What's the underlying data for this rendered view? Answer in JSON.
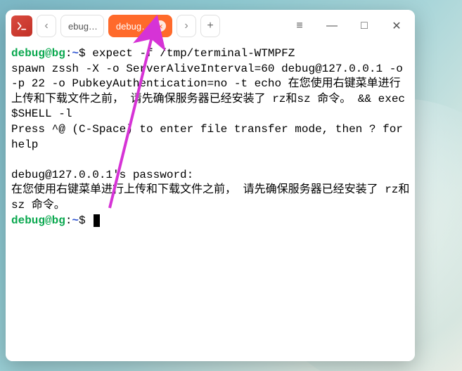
{
  "tabs": {
    "prev_glyph": "‹",
    "next_glyph": "›",
    "add_glyph": "+",
    "inactive_label": "ebug…",
    "active_label": "debug…",
    "close_glyph": "×"
  },
  "window_controls": {
    "menu": "≡",
    "minimize": "—",
    "maximize": "□",
    "close": "✕"
  },
  "terminal": {
    "prompt_user": "debug@bg",
    "prompt_sep": ":",
    "prompt_path": "~",
    "prompt_char": "$",
    "line1_cmd": " expect -f /tmp/terminal-WTMPFZ",
    "line2": "spawn zssh -X -o ServerAliveInterval=60 debug@127.0.0.1 -o -p 22 -o PubkeyAuthentication=no -t echo 在您使用右键菜单进行上传和下载文件之前， 请先确保服务器已经安装了 rz和sz 命令。 && exec $SHELL -l",
    "line3": "Press ^@ (C-Space) to enter file transfer mode, then ? for help",
    "blank": "",
    "line4": "debug@127.0.0.1's password:",
    "line5": "在您使用右键菜单进行上传和下载文件之前， 请先确保服务器已经安装了 rz和sz 命令。"
  }
}
